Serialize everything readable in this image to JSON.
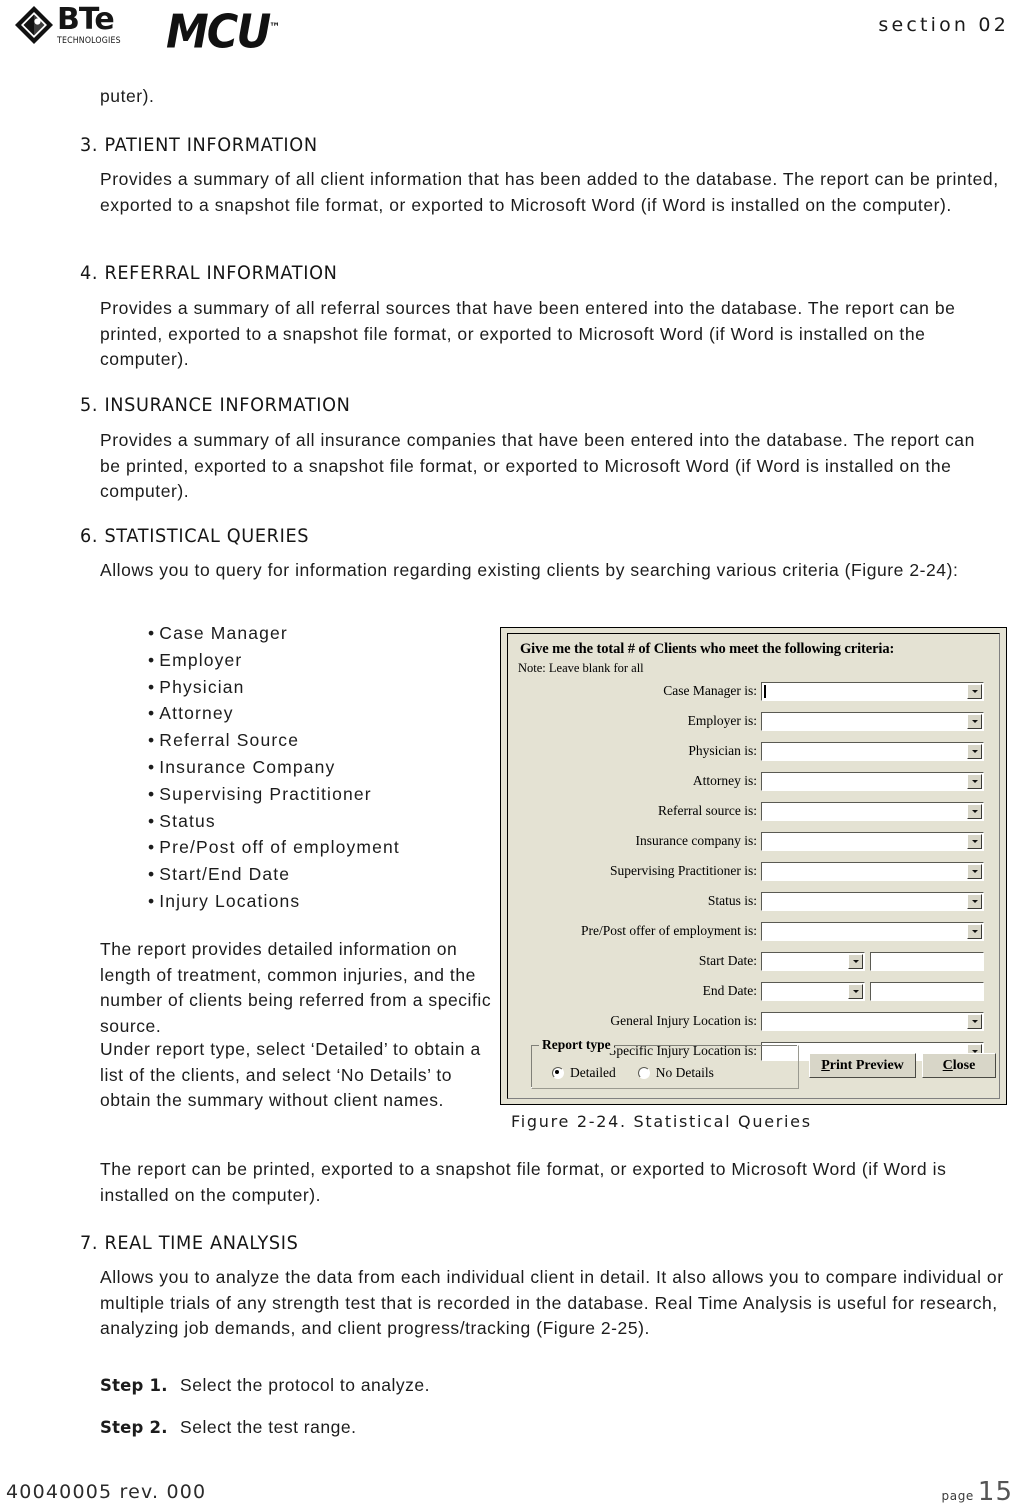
{
  "header": {
    "brand_mark": "bte-diamond-logo",
    "brand_name": "BTe",
    "brand_sub": "TECHNOLOGIES",
    "product": "MCU",
    "trademark": "™",
    "section": "section 02"
  },
  "body": {
    "orphan_line": "puter).",
    "sections": [
      {
        "number": "3.",
        "title": "PATIENT INFORMATION",
        "paragraph": "Provides a summary of all client information that has been added to the database. The report can be printed, exported to a snapshot file format, or exported to Microsoft Word (if Word is installed on the computer)."
      },
      {
        "number": "4.",
        "title": "REFERRAL INFORMATION",
        "paragraph": "Provides a summary of all referral sources that have been entered into the database. The report can be printed, exported to a snapshot file format, or exported to Microsoft Word (if Word is installed on the computer)."
      },
      {
        "number": "5.",
        "title": "INSURANCE INFORMATION",
        "paragraph": "Provides a summary of all insurance companies that have been entered into the database. The report can be printed, exported to a snapshot file format, or exported to Microsoft Word (if Word is installed on the computer)."
      },
      {
        "number": "6.",
        "title": "STATISTICAL QUERIES",
        "paragraph": "Allows you to query for information regarding existing clients by searching various criteria (Figure 2-24):"
      },
      {
        "number": "7.",
        "title": "REAL TIME ANALYSIS",
        "paragraph": "Allows you to analyze the data from each individual client in detail. It also allows you to compare individual or multiple trials of any strength test that is recorded in the database. Real Time Analysis is useful for research, analyzing job demands, and client progress/tracking (Figure 2-25)."
      }
    ],
    "criteria_bullets": [
      "Case Manager",
      "Employer",
      "Physician",
      "Attorney",
      "Referral Source",
      "Insurance Company",
      "Supervising Practitioner",
      "Status",
      "Pre/Post off of employment",
      "Start/End Date",
      "Injury Locations"
    ],
    "bullet_glyph": "•",
    "side_paragraph_1": "The report provides detailed information on length of treatment, common injuries, and the number of clients being referred from a specific source.",
    "side_paragraph_2": "Under report type, select ‘Detailed’ to obtain a list of the clients, and select ‘No Details’ to obtain the summary without client names.",
    "closing_paragraph": "The report can be printed, exported to a snapshot file format, or exported to Microsoft Word (if Word is installed on the computer).",
    "figure_caption": "Figure 2-24. Statistical Queries",
    "steps": [
      {
        "label": "Step 1.",
        "text": "Select the protocol to analyze."
      },
      {
        "label": "Step 2.",
        "text": "Select the test range."
      }
    ]
  },
  "dialog": {
    "title": "Give me the total # of Clients who meet the following criteria:",
    "note": "Note: Leave blank for all",
    "background_color": "#e4e2d3",
    "fields": [
      {
        "label": "Case Manager is:",
        "value": "",
        "type": "combo",
        "focused": true
      },
      {
        "label": "Employer  is:",
        "value": "",
        "type": "combo",
        "focused": false
      },
      {
        "label": "Physician  is:",
        "value": "",
        "type": "combo",
        "focused": false
      },
      {
        "label": "Attorney  is:",
        "value": "",
        "type": "combo",
        "focused": false
      },
      {
        "label": "Referral source  is:",
        "value": "",
        "type": "combo",
        "focused": false
      },
      {
        "label": "Insurance company is:",
        "value": "",
        "type": "combo",
        "focused": false
      },
      {
        "label": "Supervising Practitioner is:",
        "value": "",
        "type": "combo",
        "focused": false
      },
      {
        "label": "Status is:",
        "value": "",
        "type": "combo",
        "focused": false
      },
      {
        "label": "Pre/Post offer of employment is:",
        "value": "",
        "type": "combo",
        "focused": false
      },
      {
        "label": "Start Date:",
        "value": "",
        "type": "combo-plus-text",
        "focused": false
      },
      {
        "label": "End Date:",
        "value": "",
        "type": "combo-plus-text",
        "focused": false
      },
      {
        "label": "General Injury Location is:",
        "value": "",
        "type": "combo",
        "focused": false
      },
      {
        "label": "Specific Injury Location is:",
        "value": "",
        "type": "combo",
        "focused": false
      }
    ],
    "report_type": {
      "group_label": "Report type",
      "options": [
        {
          "label": "Detailed",
          "selected": true
        },
        {
          "label": "No Details",
          "selected": false
        }
      ]
    },
    "buttons": [
      {
        "label": "Print Preview",
        "accel": "P"
      },
      {
        "label": "Close",
        "accel": "C"
      }
    ],
    "dropdown_icon": "chevron-down-icon"
  },
  "footer": {
    "doc_id": "40040005 rev. 000",
    "page_word": "page",
    "page_number": "15"
  }
}
